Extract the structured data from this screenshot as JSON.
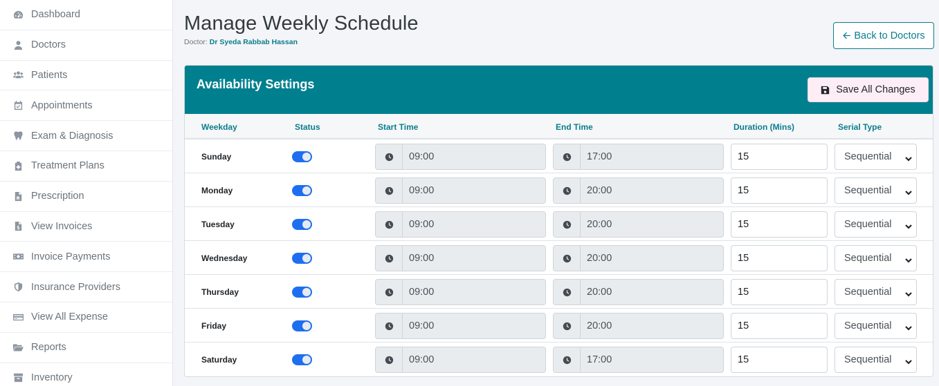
{
  "sidebar": {
    "items": [
      {
        "label": "Dashboard",
        "icon": "dashboard-icon"
      },
      {
        "label": "Doctors",
        "icon": "doctor-icon"
      },
      {
        "label": "Patients",
        "icon": "users-icon"
      },
      {
        "label": "Appointments",
        "icon": "calendar-check-icon"
      },
      {
        "label": "Exam & Diagnosis",
        "icon": "tooth-icon"
      },
      {
        "label": "Treatment Plans",
        "icon": "clipboard-medical-icon"
      },
      {
        "label": "Prescription",
        "icon": "prescription-file-icon"
      },
      {
        "label": "View Invoices",
        "icon": "invoice-file-icon"
      },
      {
        "label": "Invoice Payments",
        "icon": "money-bill-icon"
      },
      {
        "label": "Insurance Providers",
        "icon": "shield-icon"
      },
      {
        "label": "View All Expense",
        "icon": "credit-card-icon"
      },
      {
        "label": "Reports",
        "icon": "folder-open-icon"
      },
      {
        "label": "Inventory",
        "icon": "box-icon"
      }
    ]
  },
  "header": {
    "title": "Manage Weekly Schedule",
    "doctor_prefix": "Doctor:",
    "doctor_name": "Dr Syeda Rabbab Hassan",
    "back_label": "Back to Doctors"
  },
  "card": {
    "title": "Availability Settings",
    "save_label": "Save All Changes"
  },
  "table": {
    "columns": {
      "weekday": "Weekday",
      "status": "Status",
      "start": "Start Time",
      "end": "End Time",
      "duration": "Duration (Mins)",
      "serial": "Serial Type"
    },
    "rows": [
      {
        "day": "Sunday",
        "enabled": true,
        "start": "09:00",
        "end": "17:00",
        "duration": "15",
        "serial": "Sequential"
      },
      {
        "day": "Monday",
        "enabled": true,
        "start": "09:00",
        "end": "20:00",
        "duration": "15",
        "serial": "Sequential"
      },
      {
        "day": "Tuesday",
        "enabled": true,
        "start": "09:00",
        "end": "20:00",
        "duration": "15",
        "serial": "Sequential"
      },
      {
        "day": "Wednesday",
        "enabled": true,
        "start": "09:00",
        "end": "20:00",
        "duration": "15",
        "serial": "Sequential"
      },
      {
        "day": "Thursday",
        "enabled": true,
        "start": "09:00",
        "end": "20:00",
        "duration": "15",
        "serial": "Sequential"
      },
      {
        "day": "Friday",
        "enabled": true,
        "start": "09:00",
        "end": "20:00",
        "duration": "15",
        "serial": "Sequential"
      },
      {
        "day": "Saturday",
        "enabled": true,
        "start": "09:00",
        "end": "17:00",
        "duration": "15",
        "serial": "Sequential"
      }
    ]
  },
  "colors": {
    "accent": "#00808f",
    "toggle_on": "#1e6ff0",
    "save_bg": "#fdeef6"
  }
}
